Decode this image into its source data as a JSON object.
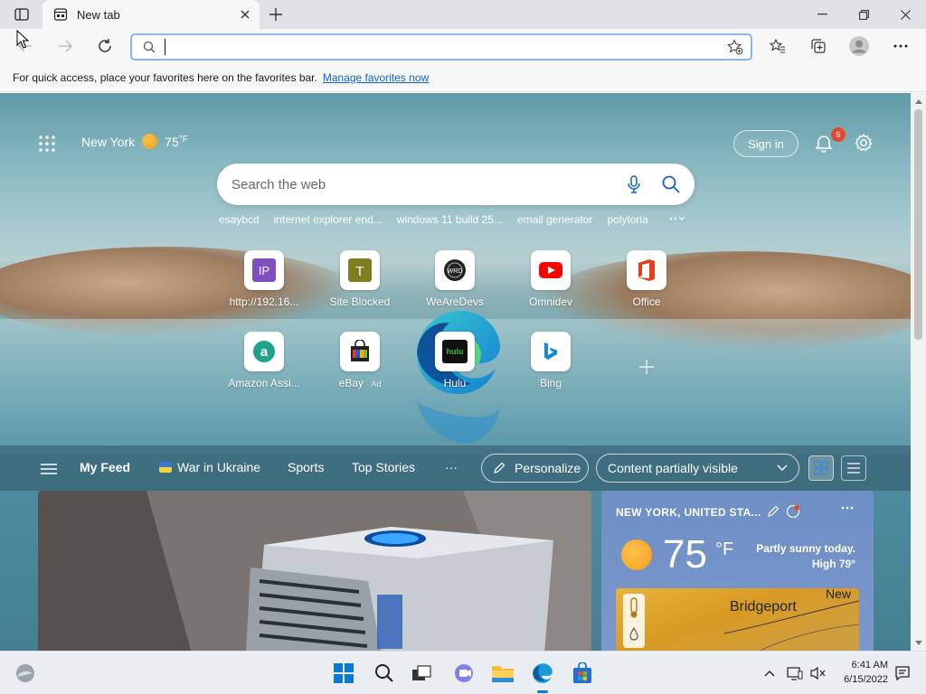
{
  "browser": {
    "tab_title": "New tab",
    "address_value": "",
    "favorites_message": "For quick access, place your favorites here on the favorites bar.",
    "manage_favorites": "Manage favorites now"
  },
  "ntp": {
    "location": "New York",
    "temp": "75",
    "temp_unit": "°F",
    "sign_in": "Sign in",
    "notification_count": "6",
    "search_placeholder": "Search the web",
    "trending": [
      "esaybcd",
      "internet explorer end...",
      "windows 11 build 25...",
      "email generator",
      "polytoria"
    ],
    "tiles": [
      {
        "label": "http://192.16...",
        "icon": "ip-icon"
      },
      {
        "label": "Site Blocked",
        "icon": "t-icon"
      },
      {
        "label": "WeAreDevs",
        "icon": "wrd-icon"
      },
      {
        "label": "Omnidev",
        "icon": "youtube-icon"
      },
      {
        "label": "Office",
        "icon": "office-icon"
      },
      {
        "label": "Amazon Assi...",
        "icon": "amazon-icon"
      },
      {
        "label": "eBay",
        "ad": "· Ad",
        "icon": "ebay-icon"
      },
      {
        "label": "Hulu",
        "icon": "hulu-icon"
      },
      {
        "label": "Bing",
        "icon": "bing-icon"
      }
    ],
    "hulu_text": "hulu",
    "feed": {
      "my_feed": "My Feed",
      "war": "War in Ukraine",
      "sports": "Sports",
      "top_stories": "Top Stories",
      "more": "···",
      "personalize": "Personalize",
      "content_visibility": "Content partially visible"
    },
    "weather_card": {
      "location": "NEW YORK, UNITED STA...",
      "temp": "75",
      "unit": "°F",
      "desc_line1": "Partly sunny today.",
      "desc_line2": "High 79°",
      "map_city": "Bridgeport",
      "map_city2": "New"
    }
  },
  "taskbar": {
    "time": "6:41 AM",
    "date": "6/15/2022"
  },
  "colors": {
    "accent": "#0e63c9",
    "badge": "#e24a30",
    "sun": "#f29a1a"
  }
}
